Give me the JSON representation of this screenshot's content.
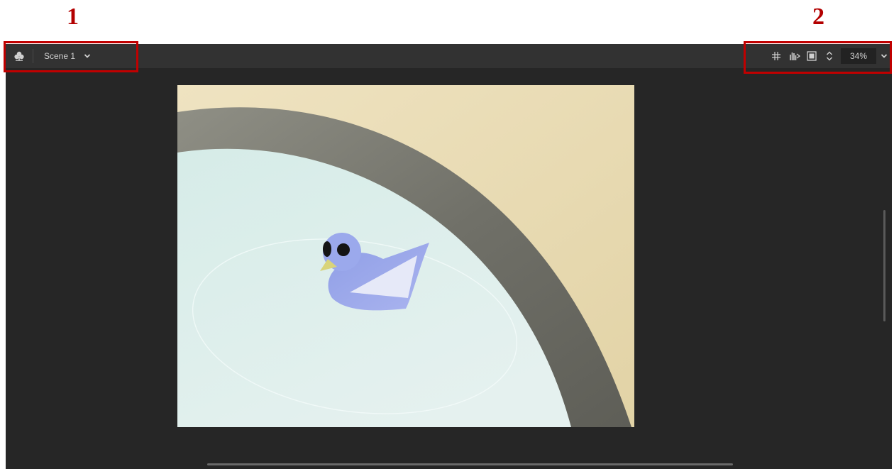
{
  "callouts": {
    "one": "1",
    "two": "2"
  },
  "toolbar": {
    "scene_icon": "scene-icon",
    "scene_label": "Scene 1",
    "tools": [
      "snap-to-center-icon",
      "clip-content-icon",
      "stage-frame-icon"
    ],
    "zoom_value": "34%"
  },
  "colors": {
    "highlight": "#c00000",
    "app_bg": "#262626",
    "toolbar_bg": "#323232",
    "callout_text": "#b30000"
  }
}
